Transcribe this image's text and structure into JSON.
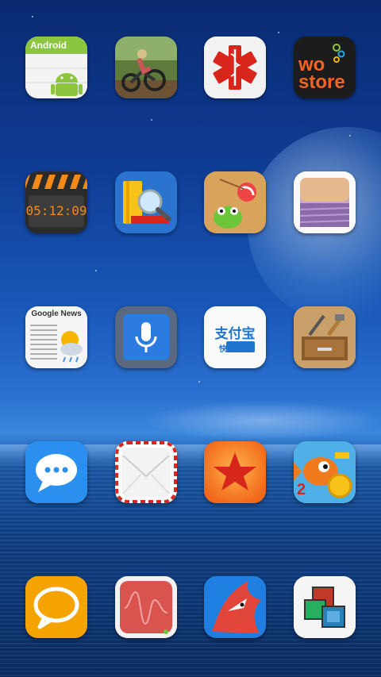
{
  "colors": {
    "sky": "#0f3c94",
    "sea": "#0a2c62",
    "android_green": "#8cc63f",
    "clock_orange": "#f28a1a",
    "alipay_blue": "#1f75cf",
    "woStore_orange": "#f26522"
  },
  "home_screen": {
    "icons": [
      {
        "icon": "android-calendar-icon",
        "text": "Android"
      },
      {
        "icon": "motorbike-game-icon",
        "text": ""
      },
      {
        "icon": "medical-star-of-life-icon",
        "text": ""
      },
      {
        "icon": "wo-store-icon",
        "text_wo": "wo",
        "text_store": "store"
      },
      {
        "icon": "clapperboard-clock-icon",
        "text": "05:12:09"
      },
      {
        "icon": "book-search-icon",
        "text": ""
      },
      {
        "icon": "cut-the-rope-icon",
        "text": ""
      },
      {
        "icon": "photo-gallery-icon",
        "text": ""
      },
      {
        "icon": "google-news-icon",
        "text": "Google News"
      },
      {
        "icon": "voice-search-icon",
        "text": ""
      },
      {
        "icon": "alipay-icon",
        "text_main": "支付宝",
        "text_sub": "快捷支付"
      },
      {
        "icon": "toolbox-icon",
        "text": ""
      },
      {
        "icon": "messages-icon",
        "text": ""
      },
      {
        "icon": "mail-envelope-icon",
        "text": ""
      },
      {
        "icon": "favorites-star-icon",
        "text": ""
      },
      {
        "icon": "fish-game-icon",
        "text": "2"
      },
      {
        "icon": "chat-bubble-icon",
        "text": ""
      },
      {
        "icon": "sound-wave-icon",
        "text": ""
      },
      {
        "icon": "bird-game-icon",
        "text": ""
      },
      {
        "icon": "windows-switcher-icon",
        "text": ""
      }
    ]
  }
}
